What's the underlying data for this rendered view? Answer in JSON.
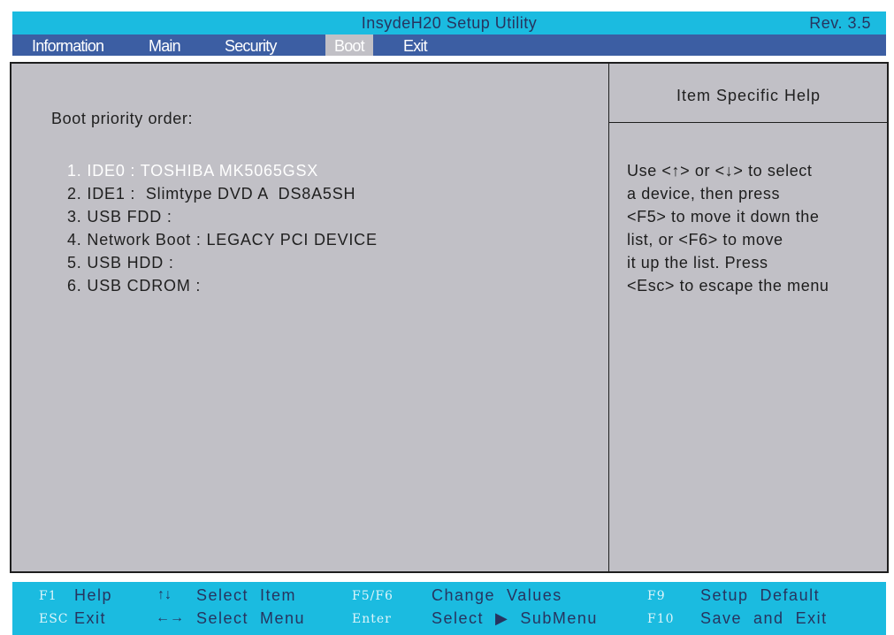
{
  "title": "InsydeH20 Setup Utility",
  "revision": "Rev. 3.5",
  "menu": [
    "Information",
    "Main",
    "Security",
    "Boot",
    "Exit"
  ],
  "active_menu": "Boot",
  "main": {
    "heading": "Boot priority order:",
    "items": [
      "1. IDE0 : TOSHIBA MK5065GSX",
      "2. IDE1 :  Slimtype DVD A  DS8A5SH",
      "3. USB FDD :",
      "4. Network Boot : LEGACY PCI DEVICE",
      "5. USB HDD :",
      "6. USB CDROM :"
    ],
    "selected_index": 0
  },
  "help": {
    "title": "Item Specific Help",
    "lines": [
      "Use <↑> or <↓> to select",
      "a device, then press",
      "<F5> to move it down the",
      "list, or <F6> to move",
      "it up the list. Press",
      "<Esc> to escape the menu"
    ]
  },
  "footer": {
    "row1": [
      {
        "key": "F1",
        "desc": "Help"
      },
      {
        "key": "↑↓",
        "desc": "Select  Item"
      },
      {
        "key": "F5/F6",
        "desc": "Change  Values"
      },
      {
        "key": "F9",
        "desc": "Setup  Default"
      }
    ],
    "row2": [
      {
        "key": "ESC",
        "desc": "Exit"
      },
      {
        "key": "←→",
        "desc": "Select  Menu"
      },
      {
        "key": "Enter",
        "desc": "Select  ▶  SubMenu"
      },
      {
        "key": "F10",
        "desc": "Save  and  Exit"
      }
    ]
  },
  "colors": {
    "title_bar": "#1bbbe0",
    "menu_bar": "#3c5ea3",
    "panel": "#c1c0c6",
    "selected_text": "#ffffff"
  }
}
